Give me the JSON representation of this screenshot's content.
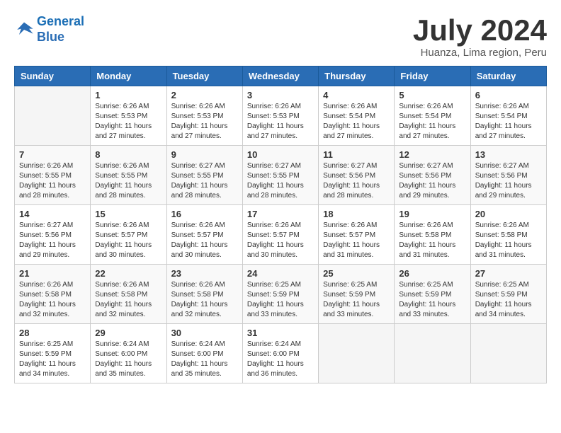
{
  "logo": {
    "line1": "General",
    "line2": "Blue"
  },
  "title": "July 2024",
  "location": "Huanza, Lima region, Peru",
  "days_of_week": [
    "Sunday",
    "Monday",
    "Tuesday",
    "Wednesday",
    "Thursday",
    "Friday",
    "Saturday"
  ],
  "weeks": [
    [
      {
        "day": "",
        "sunrise": "",
        "sunset": "",
        "daylight": ""
      },
      {
        "day": "1",
        "sunrise": "6:26 AM",
        "sunset": "5:53 PM",
        "daylight": "11 hours and 27 minutes."
      },
      {
        "day": "2",
        "sunrise": "6:26 AM",
        "sunset": "5:53 PM",
        "daylight": "11 hours and 27 minutes."
      },
      {
        "day": "3",
        "sunrise": "6:26 AM",
        "sunset": "5:53 PM",
        "daylight": "11 hours and 27 minutes."
      },
      {
        "day": "4",
        "sunrise": "6:26 AM",
        "sunset": "5:54 PM",
        "daylight": "11 hours and 27 minutes."
      },
      {
        "day": "5",
        "sunrise": "6:26 AM",
        "sunset": "5:54 PM",
        "daylight": "11 hours and 27 minutes."
      },
      {
        "day": "6",
        "sunrise": "6:26 AM",
        "sunset": "5:54 PM",
        "daylight": "11 hours and 27 minutes."
      }
    ],
    [
      {
        "day": "7",
        "sunrise": "6:26 AM",
        "sunset": "5:55 PM",
        "daylight": "11 hours and 28 minutes."
      },
      {
        "day": "8",
        "sunrise": "6:26 AM",
        "sunset": "5:55 PM",
        "daylight": "11 hours and 28 minutes."
      },
      {
        "day": "9",
        "sunrise": "6:27 AM",
        "sunset": "5:55 PM",
        "daylight": "11 hours and 28 minutes."
      },
      {
        "day": "10",
        "sunrise": "6:27 AM",
        "sunset": "5:55 PM",
        "daylight": "11 hours and 28 minutes."
      },
      {
        "day": "11",
        "sunrise": "6:27 AM",
        "sunset": "5:56 PM",
        "daylight": "11 hours and 28 minutes."
      },
      {
        "day": "12",
        "sunrise": "6:27 AM",
        "sunset": "5:56 PM",
        "daylight": "11 hours and 29 minutes."
      },
      {
        "day": "13",
        "sunrise": "6:27 AM",
        "sunset": "5:56 PM",
        "daylight": "11 hours and 29 minutes."
      }
    ],
    [
      {
        "day": "14",
        "sunrise": "6:27 AM",
        "sunset": "5:56 PM",
        "daylight": "11 hours and 29 minutes."
      },
      {
        "day": "15",
        "sunrise": "6:26 AM",
        "sunset": "5:57 PM",
        "daylight": "11 hours and 30 minutes."
      },
      {
        "day": "16",
        "sunrise": "6:26 AM",
        "sunset": "5:57 PM",
        "daylight": "11 hours and 30 minutes."
      },
      {
        "day": "17",
        "sunrise": "6:26 AM",
        "sunset": "5:57 PM",
        "daylight": "11 hours and 30 minutes."
      },
      {
        "day": "18",
        "sunrise": "6:26 AM",
        "sunset": "5:57 PM",
        "daylight": "11 hours and 31 minutes."
      },
      {
        "day": "19",
        "sunrise": "6:26 AM",
        "sunset": "5:58 PM",
        "daylight": "11 hours and 31 minutes."
      },
      {
        "day": "20",
        "sunrise": "6:26 AM",
        "sunset": "5:58 PM",
        "daylight": "11 hours and 31 minutes."
      }
    ],
    [
      {
        "day": "21",
        "sunrise": "6:26 AM",
        "sunset": "5:58 PM",
        "daylight": "11 hours and 32 minutes."
      },
      {
        "day": "22",
        "sunrise": "6:26 AM",
        "sunset": "5:58 PM",
        "daylight": "11 hours and 32 minutes."
      },
      {
        "day": "23",
        "sunrise": "6:26 AM",
        "sunset": "5:58 PM",
        "daylight": "11 hours and 32 minutes."
      },
      {
        "day": "24",
        "sunrise": "6:25 AM",
        "sunset": "5:59 PM",
        "daylight": "11 hours and 33 minutes."
      },
      {
        "day": "25",
        "sunrise": "6:25 AM",
        "sunset": "5:59 PM",
        "daylight": "11 hours and 33 minutes."
      },
      {
        "day": "26",
        "sunrise": "6:25 AM",
        "sunset": "5:59 PM",
        "daylight": "11 hours and 33 minutes."
      },
      {
        "day": "27",
        "sunrise": "6:25 AM",
        "sunset": "5:59 PM",
        "daylight": "11 hours and 34 minutes."
      }
    ],
    [
      {
        "day": "28",
        "sunrise": "6:25 AM",
        "sunset": "5:59 PM",
        "daylight": "11 hours and 34 minutes."
      },
      {
        "day": "29",
        "sunrise": "6:24 AM",
        "sunset": "6:00 PM",
        "daylight": "11 hours and 35 minutes."
      },
      {
        "day": "30",
        "sunrise": "6:24 AM",
        "sunset": "6:00 PM",
        "daylight": "11 hours and 35 minutes."
      },
      {
        "day": "31",
        "sunrise": "6:24 AM",
        "sunset": "6:00 PM",
        "daylight": "11 hours and 36 minutes."
      },
      {
        "day": "",
        "sunrise": "",
        "sunset": "",
        "daylight": ""
      },
      {
        "day": "",
        "sunrise": "",
        "sunset": "",
        "daylight": ""
      },
      {
        "day": "",
        "sunrise": "",
        "sunset": "",
        "daylight": ""
      }
    ]
  ]
}
